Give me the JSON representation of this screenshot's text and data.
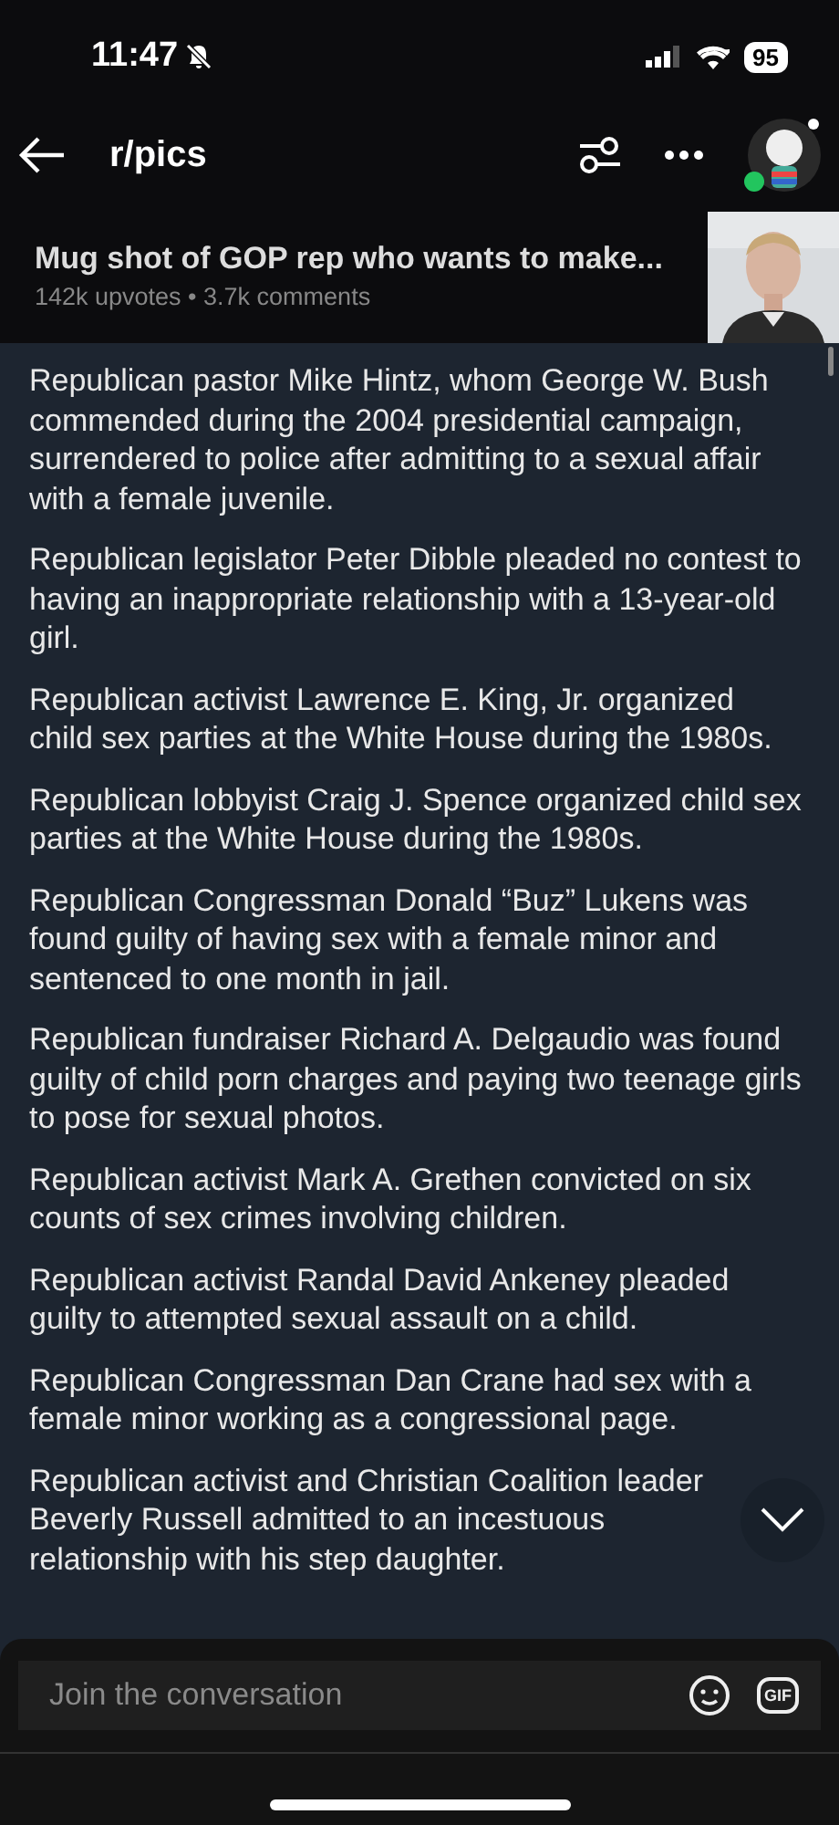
{
  "status_bar": {
    "time": "11:47",
    "battery": "95"
  },
  "header": {
    "title": "r/pics",
    "online": true
  },
  "post": {
    "title": "Mug shot of GOP rep who wants to make...",
    "meta": "142k upvotes • 3.7k comments"
  },
  "paragraphs": [
    "Republican pastor Mike Hintz, whom George W. Bush commended during the 2004 presidential campaign, surrendered to police after admitting to a sexual affair with a female juvenile.",
    "Republican legislator Peter Dibble pleaded no contest to having an inappropriate relationship with a 13-year-old girl.",
    "Republican activist Lawrence E. King, Jr. organized child sex parties at the White House during the 1980s.",
    "Republican lobbyist Craig J. Spence organized child sex parties at the White House during the 1980s.",
    "Republican Congressman Donald “Buz” Lukens was found guilty of having sex with a female minor and sentenced to one month in jail.",
    "Republican fundraiser Richard A. Delgaudio was found guilty of child porn charges and paying two teenage girls to pose for sexual photos.",
    "Republican activist Mark A. Grethen convicted on six counts of sex crimes involving children.",
    "Republican activist Randal David Ankeney pleaded guilty to attempted sexual assault on a child.",
    "Republican Congressman Dan Crane had sex with a female minor working as a congressional page.",
    "Republican activist and Christian Coalition leader Beverly Russell admitted to an incestuous relationship with his step daughter."
  ],
  "comment_bar": {
    "placeholder": "Join the conversation",
    "gif": "GIF"
  }
}
